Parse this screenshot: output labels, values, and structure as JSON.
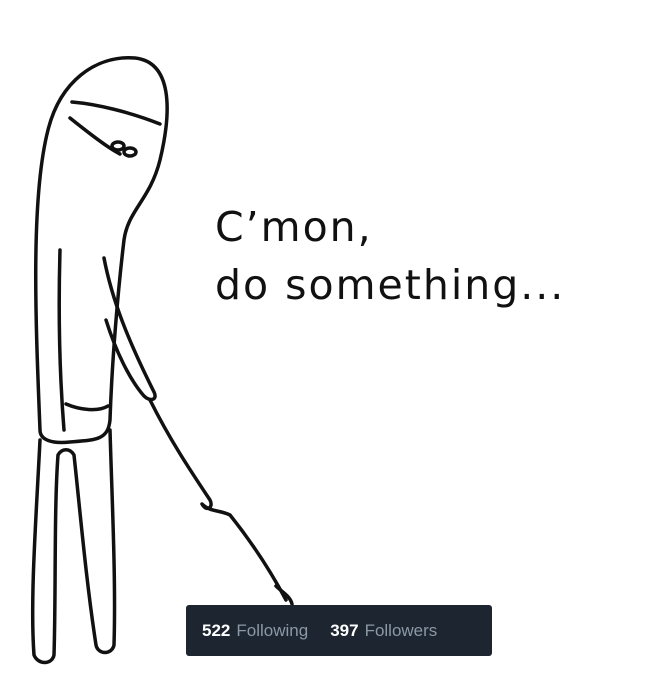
{
  "caption": {
    "line1": "C’mon,",
    "line2": "do something..."
  },
  "stats": {
    "following_count": "522",
    "following_label": "Following",
    "followers_count": "397",
    "followers_label": "Followers"
  },
  "colors": {
    "background": "#ffffff",
    "line_art": "#111111",
    "stats_bar": "#1c2530",
    "stats_count": "#ffffff",
    "stats_label": "#8b98a5"
  }
}
